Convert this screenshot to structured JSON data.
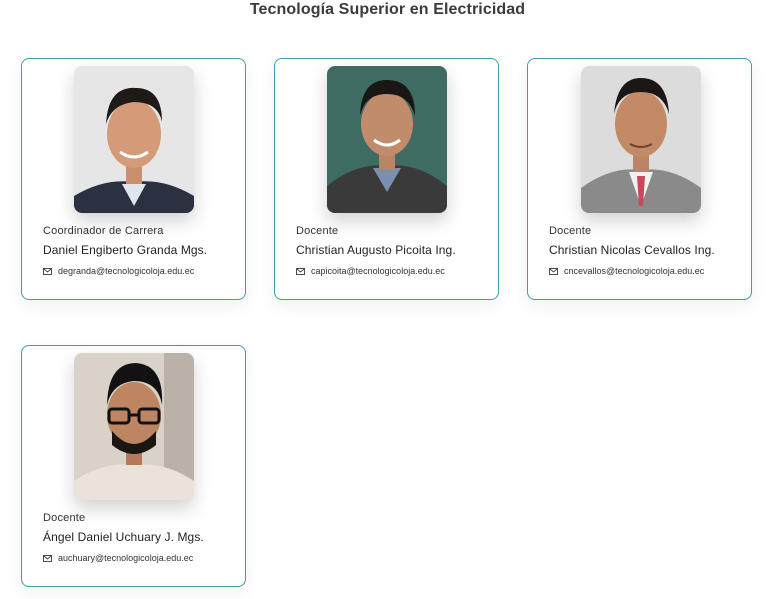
{
  "page": {
    "title": "Tecnología Superior en Electricidad"
  },
  "staff": [
    {
      "role": "Coordinador de Carrera",
      "name": "Daniel Engiberto Granda Mgs.",
      "email": "degranda@tecnologicoloja.edu.ec",
      "photo_bg": "#e6e6e6"
    },
    {
      "role": "Docente",
      "name": "Christian Augusto Picoita Ing.",
      "email": "capicoita@tecnologicoloja.edu.ec",
      "photo_bg": "#3e6b62"
    },
    {
      "role": "Docente",
      "name": "Christian Nicolas Cevallos Ing.",
      "email": "cncevallos@tecnologicoloja.edu.ec",
      "photo_bg": "#dcdcdc"
    },
    {
      "role": "Docente",
      "name": "Ángel Daniel Uchuary J. Mgs.",
      "email": "auchuary@tecnologicoloja.edu.ec",
      "photo_bg": "#d8d2c8"
    }
  ],
  "colors": {
    "card_border": "#3a9fa7",
    "title_text": "#3b3b3b"
  }
}
